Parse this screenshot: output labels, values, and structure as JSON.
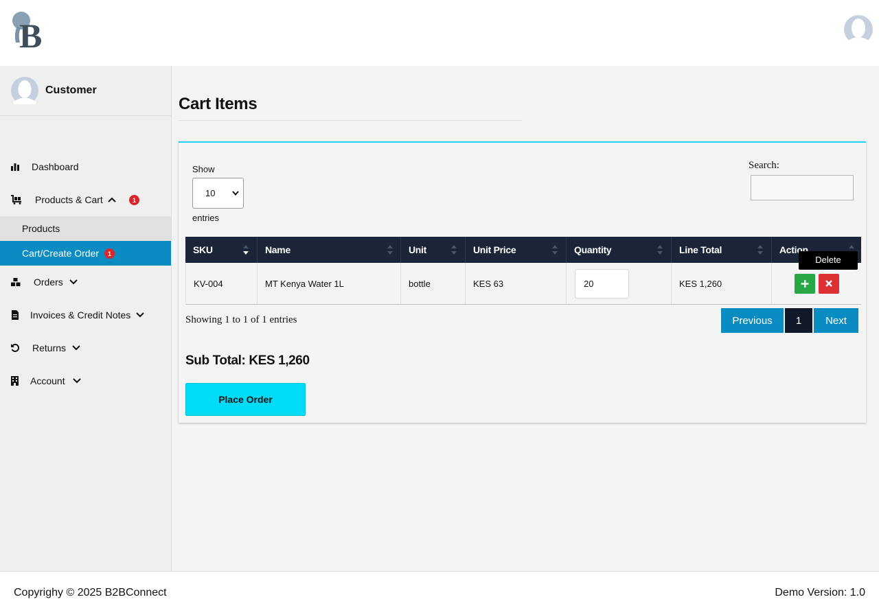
{
  "header": {
    "logo_text": "B"
  },
  "sidebar": {
    "user_name": "Customer",
    "items": [
      {
        "label": "Dashboard",
        "icon": "bar-chart-icon"
      },
      {
        "label": "Products & Cart",
        "icon": "cart-icon",
        "badge": "1"
      },
      {
        "label": "Products"
      },
      {
        "label": "Cart/Create Order",
        "badge": "1"
      },
      {
        "label": "Orders",
        "icon": "boxes-icon"
      },
      {
        "label": "Invoices & Credit Notes",
        "icon": "document-icon"
      },
      {
        "label": "Returns",
        "icon": "undo-icon"
      },
      {
        "label": "Account",
        "icon": "building-icon"
      }
    ]
  },
  "main": {
    "title": "Cart Items",
    "show_label": "Show",
    "page_size": "10",
    "entries_label": "entries",
    "search_label": "Search:",
    "search_value": "",
    "columns": [
      "SKU",
      "Name",
      "Unit",
      "Unit Price",
      "Quantity",
      "Line Total",
      "Action"
    ],
    "rows": [
      {
        "sku": "KV-004",
        "name": "MT Kenya Water 1L",
        "unit": "bottle",
        "unit_price": "KES 63",
        "quantity": "20",
        "line_total": "KES 1,260"
      }
    ],
    "tooltip": "Delete",
    "info": "Showing 1 to 1 of 1 entries",
    "pagination": {
      "previous": "Previous",
      "current": "1",
      "next": "Next"
    },
    "subtotal": "Sub Total: KES 1,260",
    "place_order": "Place Order"
  },
  "footer": {
    "copyright": "Copyrighy © 2025 B2BConnect",
    "version": "Demo Version: 1.0"
  },
  "colors": {
    "accent": "#0a8cc2",
    "cyan": "#00dcf7",
    "table_header": "#1b2537",
    "badge": "#d9262c",
    "add_button": "#28a745",
    "delete_button": "#dc3035"
  }
}
